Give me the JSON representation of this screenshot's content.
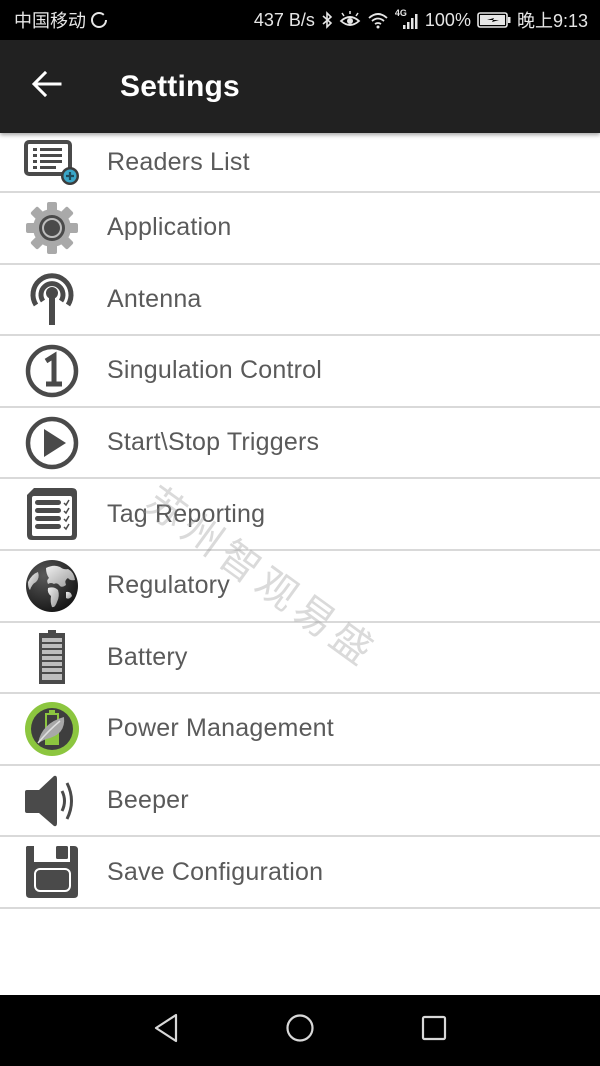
{
  "status_bar": {
    "carrier": "中国移动",
    "net_speed": "437 B/s",
    "network_type": "4G",
    "battery_percent": "100%",
    "time": "晚上9:13",
    "icons": [
      "loading-circle-icon",
      "bluetooth-icon",
      "eye-icon",
      "wifi-icon",
      "signal-icon",
      "battery-charging-icon"
    ]
  },
  "app_bar": {
    "back_icon": "arrow-left-icon",
    "title": "Settings"
  },
  "settings": {
    "items": [
      {
        "label": "Readers List",
        "icon": "readers-list-icon"
      },
      {
        "label": "Application",
        "icon": "gear-icon"
      },
      {
        "label": "Antenna",
        "icon": "antenna-icon"
      },
      {
        "label": "Singulation Control",
        "icon": "number-one-circle-icon"
      },
      {
        "label": "Start\\Stop Triggers",
        "icon": "play-circle-icon"
      },
      {
        "label": "Tag Reporting",
        "icon": "checklist-icon"
      },
      {
        "label": "Regulatory",
        "icon": "globe-icon"
      },
      {
        "label": "Battery",
        "icon": "battery-icon"
      },
      {
        "label": "Power Management",
        "icon": "power-leaf-icon"
      },
      {
        "label": "Beeper",
        "icon": "speaker-icon"
      },
      {
        "label": "Save Configuration",
        "icon": "floppy-disk-icon"
      }
    ]
  },
  "watermark": "苏州智观易盛",
  "nav_bar": {
    "back": "triangle-back-icon",
    "home": "circle-home-icon",
    "recents": "square-recents-icon"
  },
  "colors": {
    "app_bar": "#212121",
    "status_bar": "#000000",
    "icon_dark": "#4a4a4a",
    "label_text": "#5a5a5a",
    "divider": "#d9d9d9",
    "power_green": "#8cc63f",
    "add_badge": "#3aa6c8"
  }
}
